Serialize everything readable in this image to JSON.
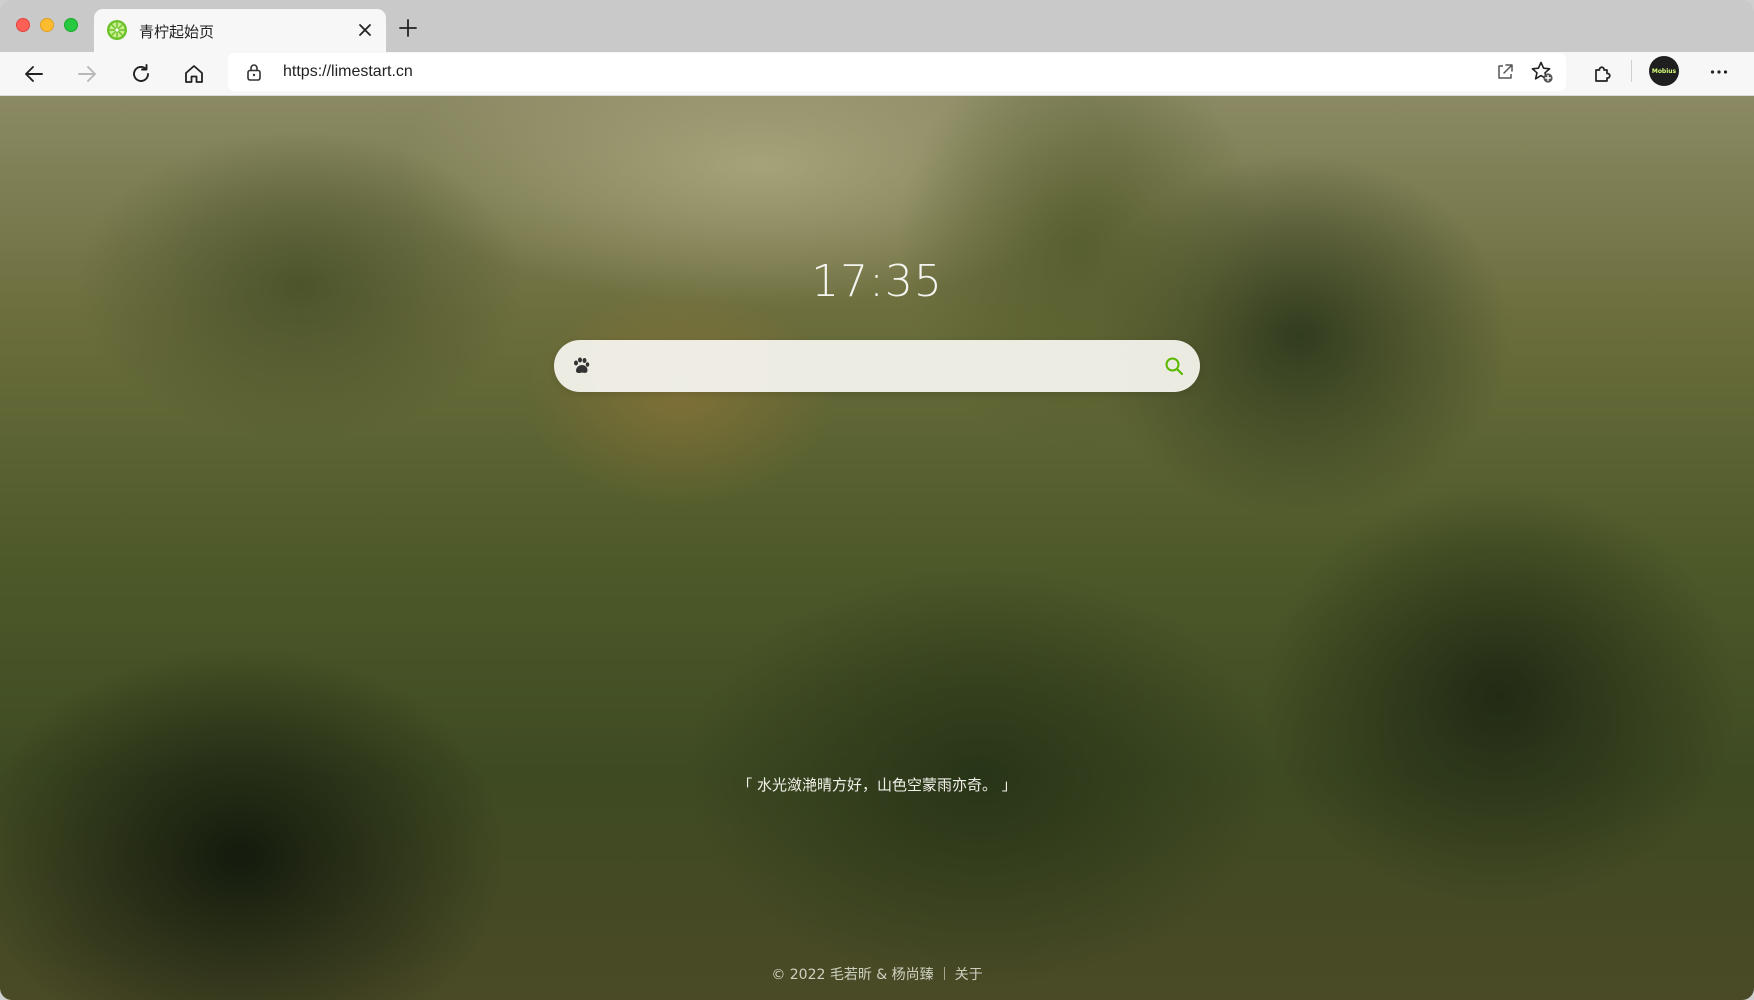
{
  "window": {
    "traffic_lights": [
      "close",
      "minimize",
      "zoom"
    ]
  },
  "tab": {
    "title": "青柠起始页",
    "favicon": "lime-icon",
    "close_icon": "close-icon"
  },
  "toolbar": {
    "back_icon": "back-arrow-icon",
    "forward_icon": "forward-arrow-icon",
    "reload_icon": "reload-icon",
    "home_icon": "home-icon",
    "url": "https://limestart.cn",
    "extensions_icon": "puzzle-icon",
    "profile_label": "Mobius",
    "menu_icon": "more-icon"
  },
  "page": {
    "clock": "17:35",
    "search": {
      "engine_icon": "paw-icon",
      "placeholder": "",
      "button_icon": "search-icon"
    },
    "quote": "「 水光潋滟晴方好，山色空蒙雨亦奇。 」",
    "footer": {
      "copyright": "© 2022 毛若昕 & 杨尚臻",
      "about": "关于"
    }
  },
  "colors": {
    "accent": "#5bb800",
    "tabbar_bg": "#c9c9c9",
    "toolbar_bg": "#f7f7f7"
  }
}
